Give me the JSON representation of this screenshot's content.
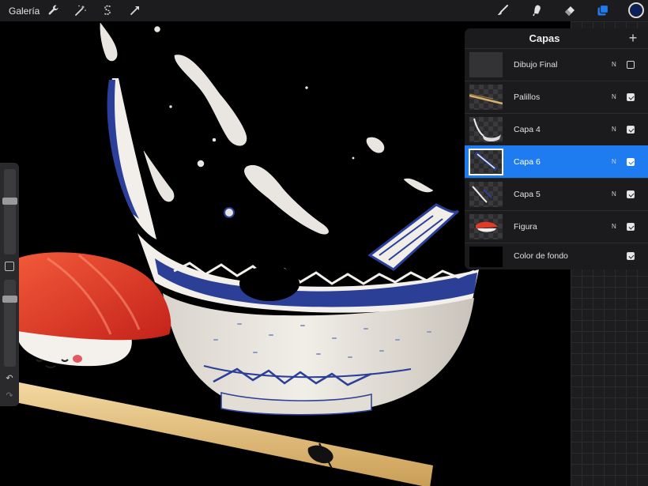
{
  "toolbar": {
    "gallery_label": "Galería",
    "left_tools": [
      "wrench-icon",
      "magic-wand-icon",
      "selection-s-icon",
      "transform-arrow-icon"
    ],
    "right_tools": [
      "brush-icon",
      "smudge-icon",
      "eraser-icon",
      "layers-icon",
      "color-icon"
    ],
    "active_tool": "layers-icon",
    "current_color": "#0b1f5a",
    "accent_color": "#1f7cf0"
  },
  "sidebar": {
    "brush_size_level": 0.36,
    "opacity_level": 0.2,
    "undo_icon": "undo-icon",
    "redo_icon": "redo-icon"
  },
  "layers_panel": {
    "title": "Capas",
    "add_symbol": "+",
    "layers": [
      {
        "name": "Dibujo Final",
        "blend": "N",
        "visible": false,
        "selected": false
      },
      {
        "name": "Palillos",
        "blend": "N",
        "visible": true,
        "selected": false
      },
      {
        "name": "Capa 4",
        "blend": "N",
        "visible": true,
        "selected": false
      },
      {
        "name": "Capa 6",
        "blend": "N",
        "visible": true,
        "selected": true
      },
      {
        "name": "Capa 5",
        "blend": "N",
        "visible": true,
        "selected": false
      },
      {
        "name": "Figura",
        "blend": "N",
        "visible": true,
        "selected": false
      },
      {
        "name": "Color de fondo",
        "blend": "",
        "visible": true,
        "selected": false
      }
    ]
  }
}
